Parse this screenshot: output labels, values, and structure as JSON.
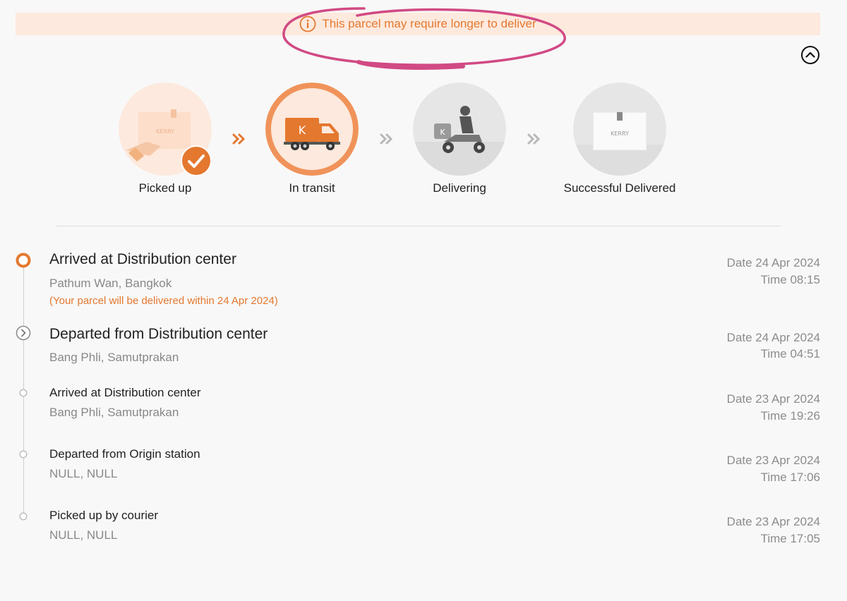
{
  "notice": {
    "message": "This parcel may require longer to deliver",
    "icon": "info-icon"
  },
  "collapse": {
    "icon": "chevron-up-icon"
  },
  "steps": [
    {
      "label": "Picked up",
      "status": "done"
    },
    {
      "label": "In transit",
      "status": "current"
    },
    {
      "label": "Delivering",
      "status": "pending"
    },
    {
      "label": "Successful Delivered",
      "status": "pending"
    }
  ],
  "events": [
    {
      "title": "Arrived at Distribution center",
      "location": "Pathum Wan, Bangkok",
      "note": "(Your parcel will be delivered within 24 Apr 2024)",
      "date": "Date 24 Apr 2024",
      "time": "Time 08:15"
    },
    {
      "title": "Departed from Distribution center",
      "location": "Bang Phli, Samutprakan",
      "date": "Date 24 Apr 2024",
      "time": "Time 04:51"
    },
    {
      "title": "Arrived at Distribution center",
      "location": "Bang Phli, Samutprakan",
      "date": "Date 23 Apr 2024",
      "time": "Time 19:26"
    },
    {
      "title": "Departed from Origin station",
      "location": "NULL, NULL",
      "date": "Date 23 Apr 2024",
      "time": "Time 17:06"
    },
    {
      "title": "Picked up by courier",
      "location": "NULL, NULL",
      "date": "Date 23 Apr 2024",
      "time": "Time 17:05"
    }
  ],
  "colors": {
    "accent": "#e4782f",
    "banner_bg": "#fde9dd",
    "annotation": "#d14a84",
    "muted_text": "#888888"
  }
}
